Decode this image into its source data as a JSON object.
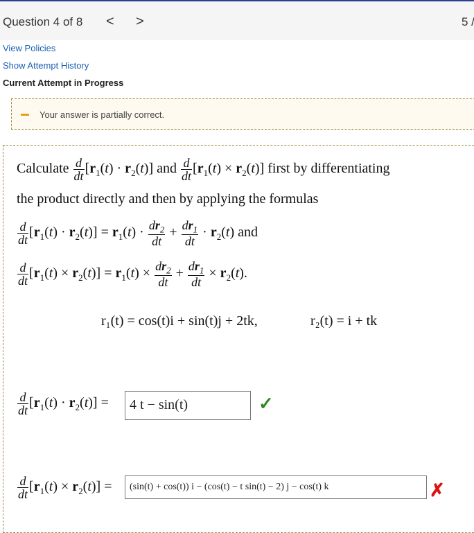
{
  "header": {
    "question_label": "Question 4 of 8",
    "prev_glyph": "<",
    "next_glyph": ">",
    "points_partial": "5 /"
  },
  "links": {
    "view_policies": "View Policies",
    "show_attempt_history": "Show Attempt History"
  },
  "attempt_status": "Current Attempt in Progress",
  "feedback": {
    "text": "Your answer is partially correct.",
    "status_color": "#e0a21a"
  },
  "question": {
    "intro_word": "Calculate",
    "and_word": "and",
    "first_by": "first by differentiating",
    "line2": "the product directly and then by applying the formulas",
    "and_word2": "and",
    "period": ".",
    "given_r1": "r₁(t) = cos(t)i + sin(t)j + 2tk,",
    "given_r2": "r₂(t) = i + tk"
  },
  "answers": {
    "dot_value": "4 t − sin(t)",
    "dot_status": "correct",
    "cross_value": "(sin(t) + cos(t)) i − (cos(t) − t sin(t) − 2) j − cos(t) k",
    "cross_status": "incorrect"
  },
  "icons": {
    "correct": "check-icon",
    "incorrect": "cross-icon"
  },
  "colors": {
    "correct": "#2e8b22",
    "incorrect": "#dd1111",
    "link": "#1a5fb4"
  }
}
